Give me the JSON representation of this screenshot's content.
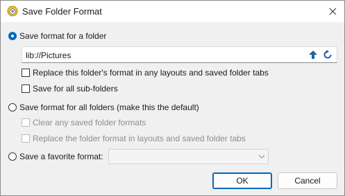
{
  "window": {
    "title": "Save Folder Format"
  },
  "options": {
    "folder_radio_label": "Save format for a folder",
    "path_value": "lib://Pictures",
    "replace_checkbox_label": "Replace this folder's format in any layouts and saved folder tabs",
    "subfolders_checkbox_label": "Save for all sub-folders",
    "all_folders_radio_label": "Save format for all folders (make this the default)",
    "clear_saved_label": "Clear any saved folder formats",
    "replace_layouts_label": "Replace the folder format in layouts and saved folder tabs",
    "favorite_radio_label": "Save a favorite format:",
    "favorite_value": ""
  },
  "buttons": {
    "ok_label": "OK",
    "cancel_label": "Cancel"
  },
  "colors": {
    "accent": "#0067c0",
    "disabled_text": "#8d8d8d",
    "dialog_bg": "#f0f0f0"
  },
  "icons": [
    "app-icon",
    "close-icon",
    "up-arrow-icon",
    "reset-icon",
    "chevron-down-icon"
  ]
}
